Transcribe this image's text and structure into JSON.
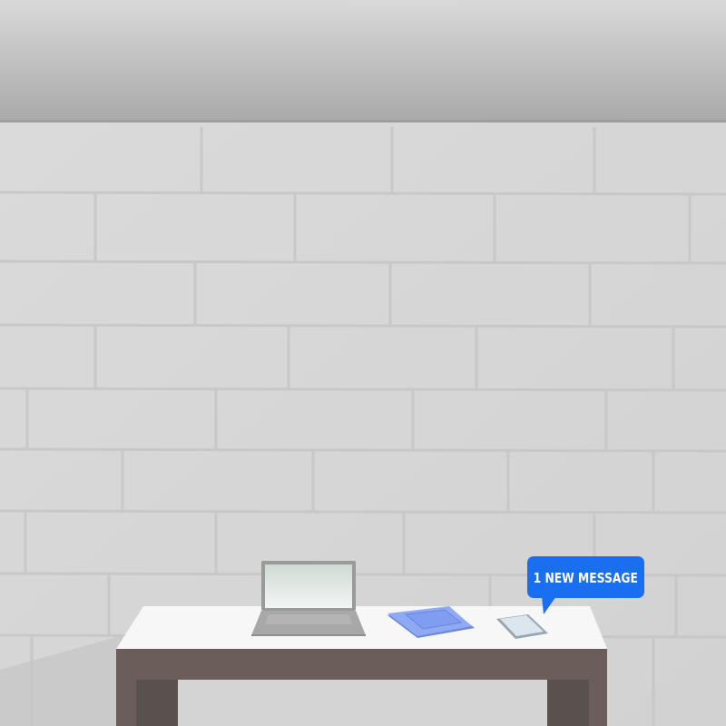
{
  "notification": {
    "label": "1 NEW MESSAGE"
  },
  "colors": {
    "wall": "#d7d7d7",
    "ceiling": "#b4b4b4",
    "table_top": "#f7f7f7",
    "table_legs": "#6a5d5a",
    "laptop_frame": "#9a9a9a",
    "laptop_screen": "#e4ede9",
    "notebook": "#7f9ef2",
    "phone": "#c9d6e0",
    "bubble": "#1a6ef0"
  },
  "icons": [
    "laptop-icon",
    "notebook-icon",
    "smartphone-icon",
    "speech-bubble-icon"
  ]
}
